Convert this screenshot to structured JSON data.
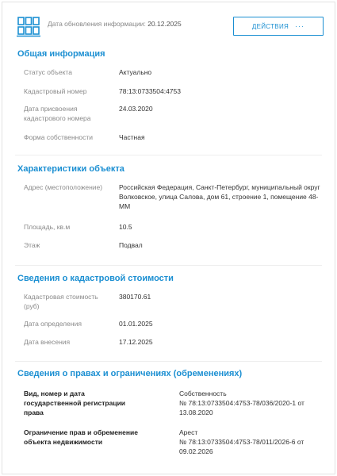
{
  "header": {
    "update_label": "Дата обновления информации:",
    "update_date": "20.12.2025",
    "actions_label": "ДЕЙСТВИЯ",
    "actions_dots": "···"
  },
  "general": {
    "title": "Общая информация",
    "rows": [
      {
        "label": "Статус объекта",
        "value": "Актуально"
      },
      {
        "label": "Кадастровый номер",
        "value": "78:13:0733504:4753"
      },
      {
        "label": "Дата присвоения кадастрового номера",
        "value": "24.03.2020"
      },
      {
        "label": "Форма собственности",
        "value": "Частная"
      }
    ]
  },
  "characteristics": {
    "title": "Характеристики объекта",
    "rows": [
      {
        "label": "Адрес (местоположение)",
        "value": "Российская Федерация, Санкт-Петербург, муниципальный округ Волковское, улица Салова, дом 61, строение 1, помещение 48-ММ"
      },
      {
        "label": "Площадь, кв.м",
        "value": "10.5"
      },
      {
        "label": "Этаж",
        "value": "Подвал"
      }
    ]
  },
  "cadastral_value": {
    "title": "Сведения о кадастровой стоимости",
    "rows": [
      {
        "label": "Кадастровая стоимость (руб)",
        "value": "380170.61"
      },
      {
        "label": "Дата определения",
        "value": "01.01.2025"
      },
      {
        "label": "Дата внесения",
        "value": "17.12.2025"
      }
    ]
  },
  "rights": {
    "title": "Сведения о правах и ограничениях (обременениях)",
    "rows": [
      {
        "label": "Вид, номер и дата государственной регистрации права",
        "value": "Собственность\n№ 78:13:0733504:4753-78/036/2020-1 от 13.08.2020"
      },
      {
        "label": "Ограничение прав и обременение объекта недвижимости",
        "value": "Арест\n№ 78:13:0733504:4753-78/011/2026-6 от 09.02.2026"
      }
    ]
  }
}
